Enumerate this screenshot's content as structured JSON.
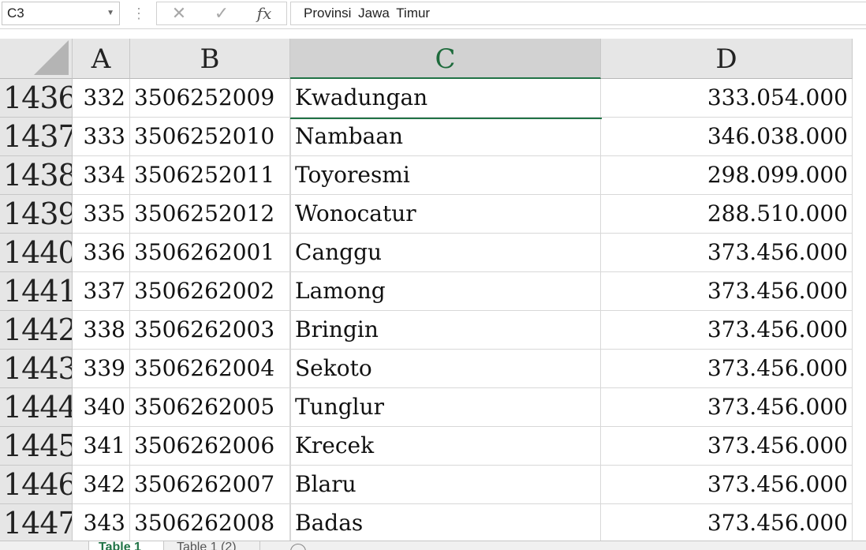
{
  "formula_bar": {
    "name_box": "C3",
    "cancel_icon": "✕",
    "enter_icon": "✓",
    "fx_label": "fx",
    "formula": "Provinsi Jawa Timur"
  },
  "columns": [
    {
      "label": "A",
      "selected": false
    },
    {
      "label": "B",
      "selected": false
    },
    {
      "label": "C",
      "selected": true
    },
    {
      "label": "D",
      "selected": false
    }
  ],
  "rows": [
    {
      "row": "1436",
      "a": "332",
      "b": "3506252009",
      "c": "Kwadungan",
      "d": "333.054.000"
    },
    {
      "row": "1437",
      "a": "333",
      "b": "3506252010",
      "c": "Nambaan",
      "d": "346.038.000"
    },
    {
      "row": "1438",
      "a": "334",
      "b": "3506252011",
      "c": "Toyoresmi",
      "d": "298.099.000"
    },
    {
      "row": "1439",
      "a": "335",
      "b": "3506252012",
      "c": "Wonocatur",
      "d": "288.510.000"
    },
    {
      "row": "1440",
      "a": "336",
      "b": "3506262001",
      "c": "Canggu",
      "d": "373.456.000"
    },
    {
      "row": "1441",
      "a": "337",
      "b": "3506262002",
      "c": "Lamong",
      "d": "373.456.000"
    },
    {
      "row": "1442",
      "a": "338",
      "b": "3506262003",
      "c": "Bringin",
      "d": "373.456.000"
    },
    {
      "row": "1443",
      "a": "339",
      "b": "3506262004",
      "c": "Sekoto",
      "d": "373.456.000"
    },
    {
      "row": "1444",
      "a": "340",
      "b": "3506262005",
      "c": "Tunglur",
      "d": "373.456.000"
    },
    {
      "row": "1445",
      "a": "341",
      "b": "3506262006",
      "c": "Krecek",
      "d": "373.456.000"
    },
    {
      "row": "1446",
      "a": "342",
      "b": "3506262007",
      "c": "Blaru",
      "d": "373.456.000"
    },
    {
      "row": "1447",
      "a": "343",
      "b": "3506262008",
      "c": "Badas",
      "d": "373.456.000"
    }
  ],
  "sheet_tabs": [
    {
      "label": "Table 1",
      "active": true
    },
    {
      "label": "Table 1 (2)",
      "active": false
    }
  ],
  "colors": {
    "accent": "#217346",
    "header_bg": "#e6e6e6"
  }
}
